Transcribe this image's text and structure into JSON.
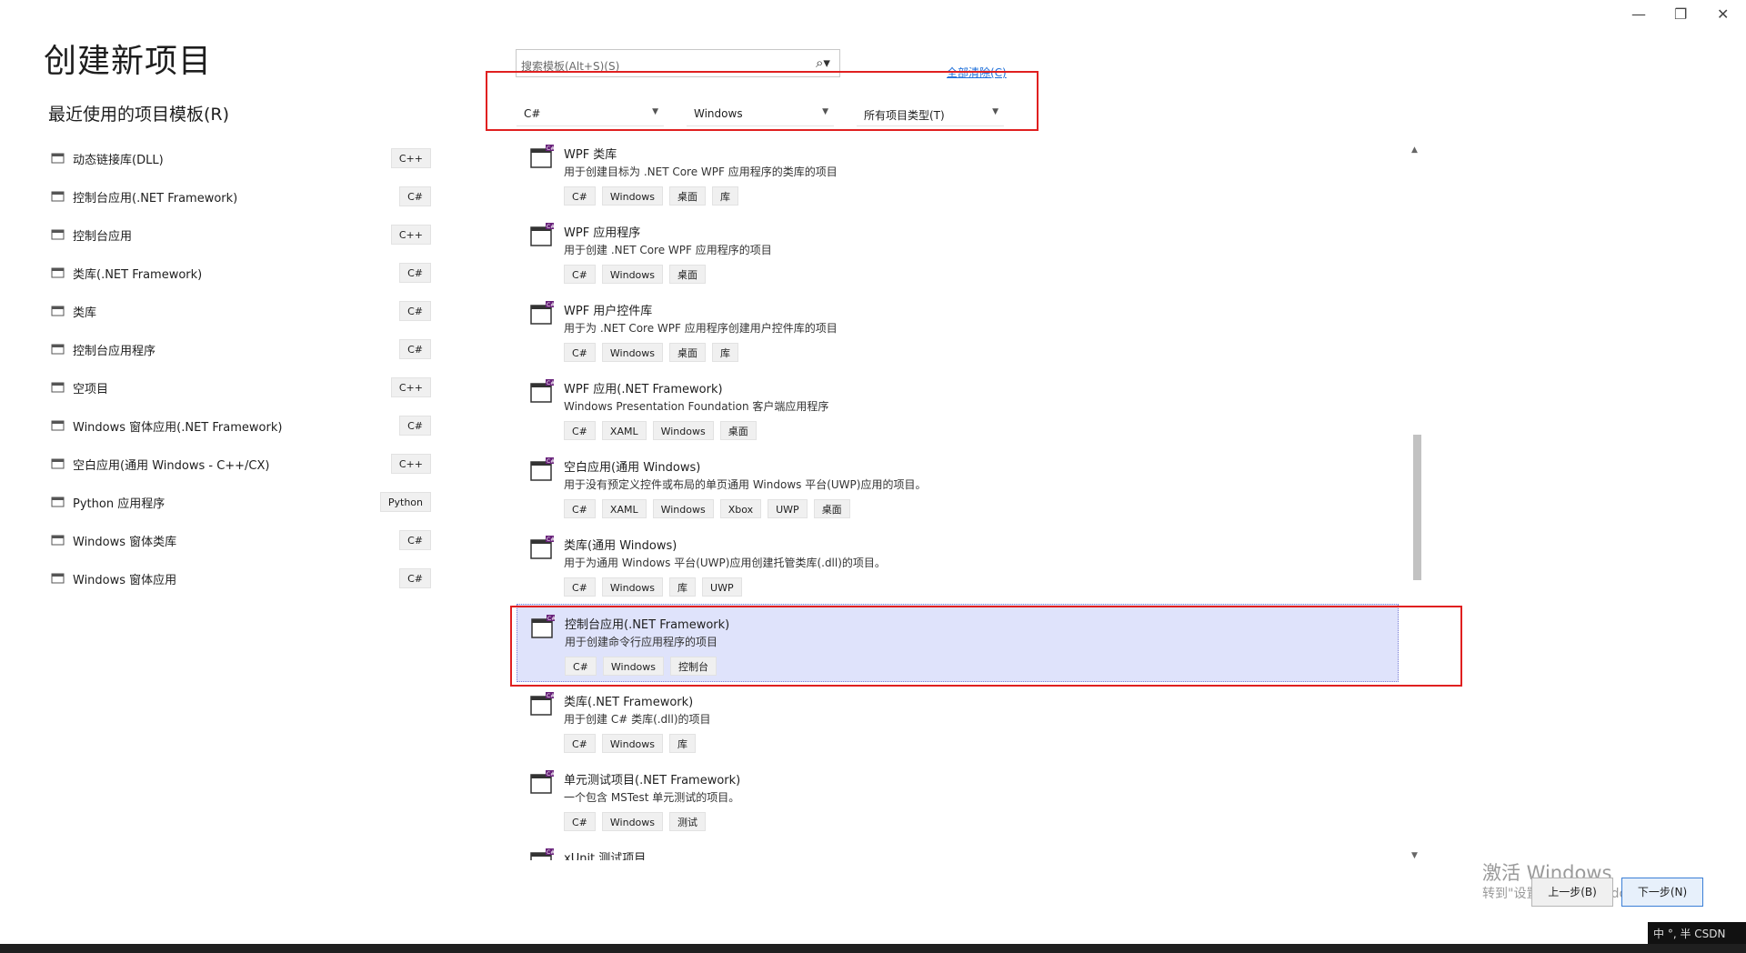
{
  "window": {
    "minimize": "—",
    "restore": "❐",
    "close": "✕"
  },
  "page_title": "创建新项目",
  "recent_title": "最近使用的项目模板(R)",
  "recent": [
    {
      "label": "动态链接库(DLL)",
      "tag": "C++"
    },
    {
      "label": "控制台应用(.NET Framework)",
      "tag": "C#"
    },
    {
      "label": "控制台应用",
      "tag": "C++"
    },
    {
      "label": "类库(.NET Framework)",
      "tag": "C#"
    },
    {
      "label": "类库",
      "tag": "C#"
    },
    {
      "label": "控制台应用程序",
      "tag": "C#"
    },
    {
      "label": "空项目",
      "tag": "C++"
    },
    {
      "label": "Windows 窗体应用(.NET Framework)",
      "tag": "C#"
    },
    {
      "label": "空白应用(通用 Windows - C++/CX)",
      "tag": "C++"
    },
    {
      "label": "Python 应用程序",
      "tag": "Python"
    },
    {
      "label": "Windows 窗体类库",
      "tag": "C#"
    },
    {
      "label": "Windows 窗体应用",
      "tag": "C#"
    }
  ],
  "search": {
    "placeholder": "搜索模板(Alt+S)(S)"
  },
  "clear_all": "全部清除(C)",
  "filters": {
    "language": "C#",
    "platform": "Windows",
    "project_type": "所有项目类型(T)"
  },
  "templates": [
    {
      "name": "WPF 类库",
      "desc": "用于创建目标为 .NET Core WPF 应用程序的类库的项目",
      "tags": [
        "C#",
        "Windows",
        "桌面",
        "库"
      ]
    },
    {
      "name": "WPF 应用程序",
      "desc": "用于创建 .NET Core WPF 应用程序的项目",
      "tags": [
        "C#",
        "Windows",
        "桌面"
      ]
    },
    {
      "name": "WPF 用户控件库",
      "desc": "用于为 .NET Core WPF 应用程序创建用户控件库的项目",
      "tags": [
        "C#",
        "Windows",
        "桌面",
        "库"
      ]
    },
    {
      "name": "WPF 应用(.NET Framework)",
      "desc": "Windows Presentation Foundation 客户端应用程序",
      "tags": [
        "C#",
        "XAML",
        "Windows",
        "桌面"
      ]
    },
    {
      "name": "空白应用(通用 Windows)",
      "desc": "用于没有预定义控件或布局的单页通用 Windows 平台(UWP)应用的项目。",
      "tags": [
        "C#",
        "XAML",
        "Windows",
        "Xbox",
        "UWP",
        "桌面"
      ]
    },
    {
      "name": "类库(通用 Windows)",
      "desc": "用于为通用 Windows 平台(UWP)应用创建托管类库(.dll)的项目。",
      "tags": [
        "C#",
        "Windows",
        "库",
        "UWP"
      ]
    },
    {
      "name": "控制台应用(.NET Framework)",
      "desc": "用于创建命令行应用程序的项目",
      "tags": [
        "C#",
        "Windows",
        "控制台"
      ],
      "selected": true
    },
    {
      "name": "类库(.NET Framework)",
      "desc": "用于创建 C# 类库(.dll)的项目",
      "tags": [
        "C#",
        "Windows",
        "库"
      ]
    },
    {
      "name": "单元测试项目(.NET Framework)",
      "desc": "一个包含 MSTest 单元测试的项目。",
      "tags": [
        "C#",
        "Windows",
        "测试"
      ]
    },
    {
      "name": "xUnit 测试项目",
      "desc": "",
      "tags": []
    }
  ],
  "watermark": {
    "line1": "激活 Windows",
    "line2": "转到\"设置\"以激活 Windows。"
  },
  "buttons": {
    "back": "上一步(B)",
    "next": "下一步(N)"
  },
  "ime": "中 °, 半 CSDN"
}
